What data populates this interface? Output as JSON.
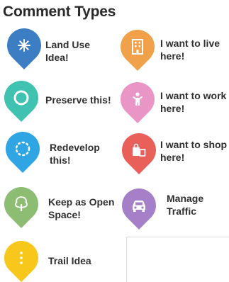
{
  "title": "Comment Types",
  "items": [
    {
      "id": "land-use",
      "line1": "Land Use",
      "line2": "Idea!",
      "color": "#3c7dc4",
      "icon": "asterisk-icon"
    },
    {
      "id": "live",
      "line1": "I want to live",
      "line2": "here!",
      "color": "#f0a14a",
      "icon": "building-icon"
    },
    {
      "id": "preserve",
      "line1": "Preserve this!",
      "line2": "",
      "color": "#3fc2b0",
      "icon": "circle-icon"
    },
    {
      "id": "work",
      "line1": "I want to work",
      "line2": "here!",
      "color": "#e996c7",
      "icon": "person-icon"
    },
    {
      "id": "redevelop",
      "line1": "Redevelop",
      "line2": "this!",
      "color": "#2fa6e3",
      "icon": "dotted-circle-icon"
    },
    {
      "id": "shop",
      "line1": "I want to shop",
      "line2": "here!",
      "color": "#e9605a",
      "icon": "shopping-bag-icon"
    },
    {
      "id": "open-space",
      "line1": "Keep as Open",
      "line2": "Space!",
      "color": "#8dbd72",
      "icon": "tree-icon"
    },
    {
      "id": "traffic",
      "line1": "Manage",
      "line2": "Traffic",
      "color": "#a67fc9",
      "icon": "car-icon"
    },
    {
      "id": "trail",
      "line1": "Trail Idea",
      "line2": "",
      "color": "#f7c71b",
      "icon": "vertical-dots-icon"
    }
  ]
}
